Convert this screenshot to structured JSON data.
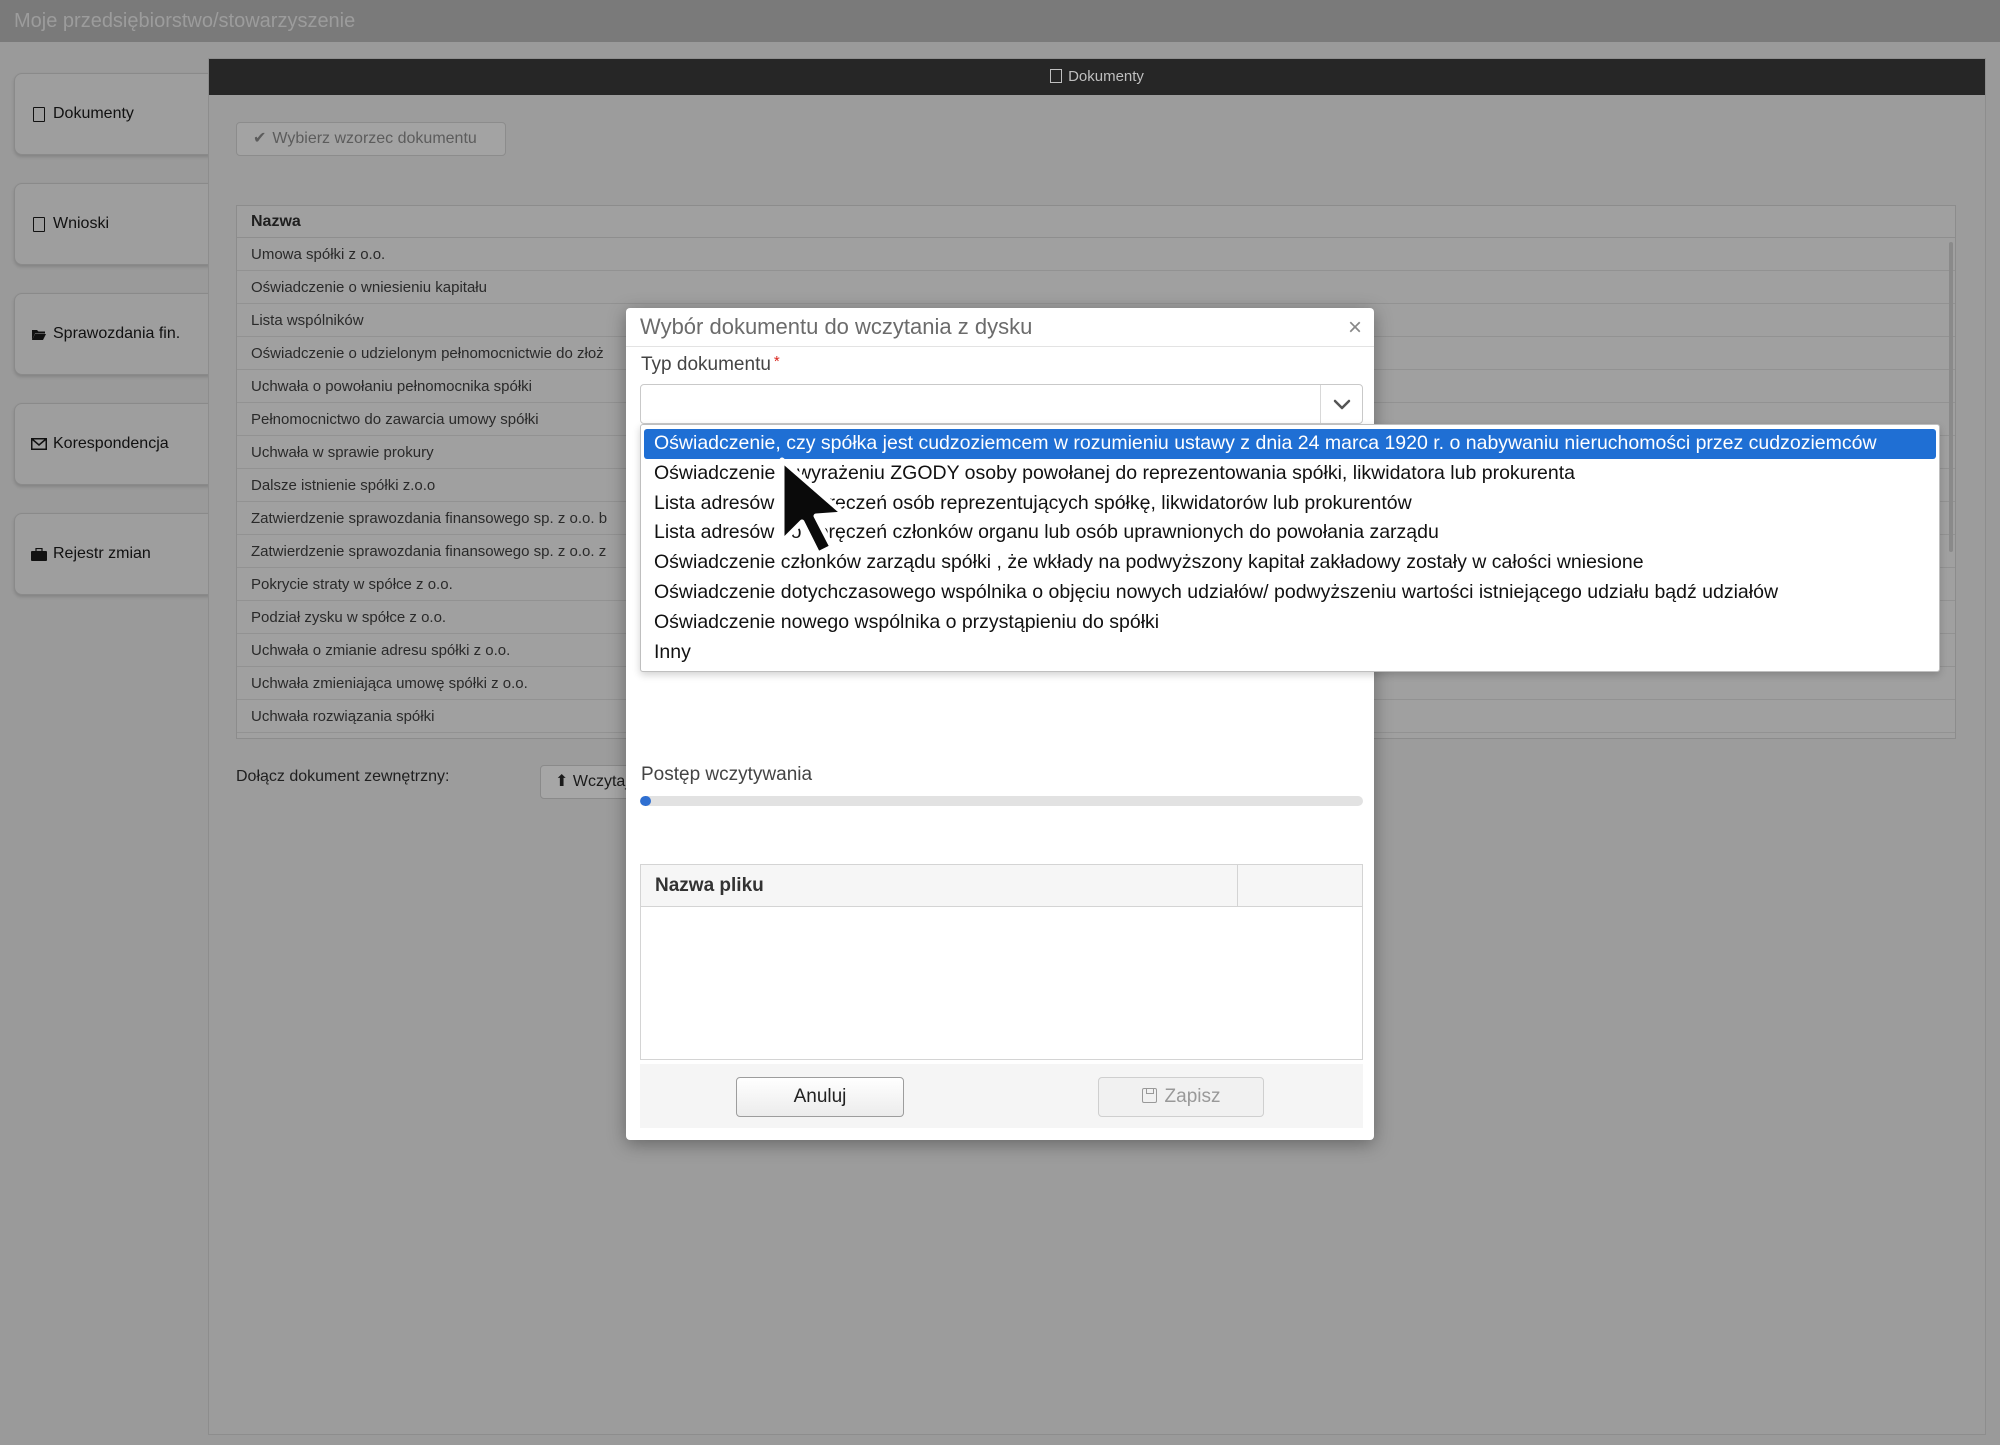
{
  "app": {
    "title": "Moje przedsiębiorstwo/stowarzyszenie"
  },
  "sidebar": {
    "items": [
      {
        "label": "Dokumenty",
        "icon": "document-icon"
      },
      {
        "label": "Wnioski",
        "icon": "document-icon"
      },
      {
        "label": "Sprawozdania fin.",
        "icon": "folder-open-icon"
      },
      {
        "label": "Korespondencja",
        "icon": "envelope-icon"
      },
      {
        "label": "Rejestr zmian",
        "icon": "briefcase-icon"
      }
    ]
  },
  "panel": {
    "header": "Dokumenty",
    "template_button": "Wybierz wzorzec dokumentu",
    "table": {
      "header": "Nazwa",
      "rows": [
        "Umowa spółki z o.o.",
        "Oświadczenie o wniesieniu kapitału",
        "Lista wspólników",
        "Oświadczenie o udzielonym pełnomocnictwie do złoż",
        "Uchwała o powołaniu pełnomocnika spółki",
        "Pełnomocnictwo do zawarcia umowy spółki",
        "Uchwała w sprawie prokury",
        "Dalsze istnienie spółki z.o.o",
        "Zatwierdzenie sprawozdania finansowego sp. z o.o. b",
        "Zatwierdzenie sprawozdania finansowego sp. z o.o. z",
        "Pokrycie straty w spółce z o.o.",
        "Podział zysku w spółce z o.o.",
        "Uchwała o zmianie adresu spółki z o.o.",
        "Uchwała zmieniająca umowę spółki z o.o.",
        "Uchwała rozwiązania spółki"
      ]
    },
    "attach_label": "Dołącz dokument zewnętrzny:",
    "attach_button": "Wczytaj"
  },
  "modal": {
    "title": "Wybór dokumentu do wczytania z dysku",
    "close": "×",
    "field_label": "Typ dokumentu",
    "required_mark": "*",
    "select_value": "",
    "progress_label": "Postęp wczytywania",
    "progress_fraction": 0.015,
    "file_table_header": "Nazwa pliku",
    "cancel_button": "Anuluj",
    "save_button": "Zapisz",
    "accent_color": "#1f6fd4"
  },
  "dropdown": {
    "selected_index": 0,
    "options": [
      "Oświadczenie, czy spółka jest cudzoziemcem w rozumieniu ustawy z dnia 24 marca 1920 r. o nabywaniu nieruchomości przez cudzoziemców",
      "Oświadczenie o wyrażeniu ZGODY osoby powołanej do reprezentowania spółki, likwidatora lub prokurenta",
      "Lista adresów do doręczeń osób reprezentujących spółkę, likwidatorów lub prokurentów",
      "Lista adresów do doręczeń członków organu lub osób uprawnionych do powołania zarządu",
      "Oświadczenie członków zarządu spółki , że wkłady na podwyższony kapitał zakładowy zostały w całości wniesione",
      "Oświadczenie dotychczasowego wspólnika o objęciu nowych udziałów/ podwyższeniu wartości istniejącego udziału bądź udziałów",
      "Oświadczenie nowego wspólnika o przystąpieniu do spółki",
      "Inny"
    ]
  }
}
